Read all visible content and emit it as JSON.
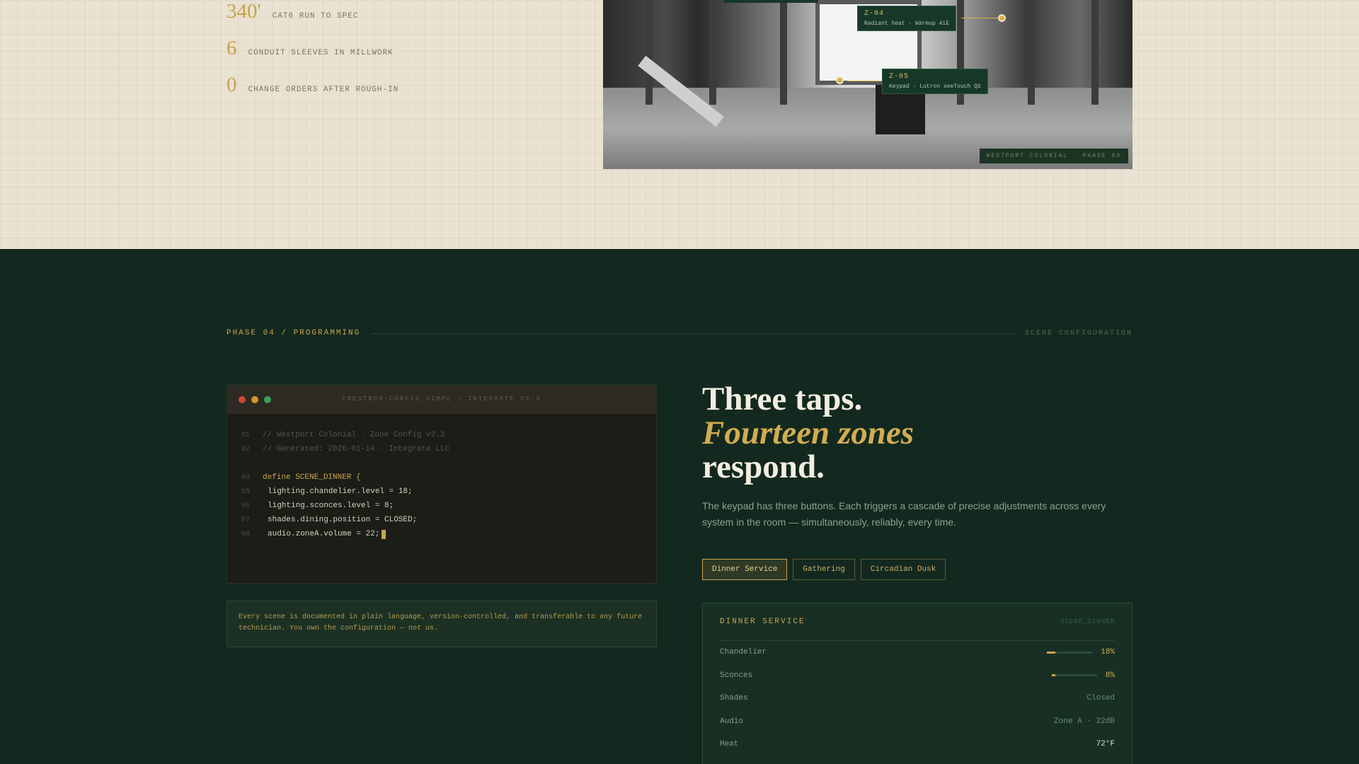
{
  "stats": [
    {
      "num": "340'",
      "label": "CAT6 RUN TO SPEC"
    },
    {
      "num": "6",
      "label": "CONDUIT SLEEVES IN MILLWORK"
    },
    {
      "num": "0",
      "label": "CHANGE ORDERS AFTER ROUGH-IN"
    }
  ],
  "photo": {
    "tags": [
      {
        "id": "Z-04",
        "desc": "Radiant heat · Warmup 4iE"
      },
      {
        "id": "Z-05",
        "desc": "Keypad · Lutron seeTouch QS"
      }
    ],
    "caption": "WESTPORT COLONIAL · PHASE 03"
  },
  "phase": {
    "label": "PHASE 04 / PROGRAMMING",
    "right": "SCENE CONFIGURATION"
  },
  "code": {
    "title": "CRESTRON-CONFIG.SIMPL — INTEGRATE V2.3",
    "lines": [
      {
        "n": "01",
        "text": "// Westport Colonial · Zone Config v2.3"
      },
      {
        "n": "02",
        "text": "// Generated: 2026-01-14 · Integrate LLC"
      },
      {
        "n": "04",
        "text": "define SCENE_DINNER {"
      },
      {
        "n": "05",
        "text": "lighting.chandelier.level = 18;"
      },
      {
        "n": "06",
        "text": "lighting.sconces.level = 8;"
      },
      {
        "n": "07",
        "text": "shades.dining.position = CLOSED;"
      },
      {
        "n": "08",
        "text": "audio.zoneA.volume = 22;"
      }
    ]
  },
  "note": "Every scene is documented in plain language, version-controlled, and transferable to any future technician. You own the configuration — not us.",
  "headline": {
    "line1": "Three taps.",
    "line2": "Fourteen zones",
    "line3": "respond."
  },
  "intro": "The keypad has three buttons. Each triggers a cascade of precise adjustments across every system in the room — simultaneously, reliably, every time.",
  "scenes": [
    {
      "label": "Dinner Service",
      "active": true
    },
    {
      "label": "Gathering",
      "active": false
    },
    {
      "label": "Circadian Dusk",
      "active": false
    }
  ],
  "panel": {
    "title": "DINNER SERVICE",
    "code": "SCENE_DINNER",
    "rows": [
      {
        "label": "Chandelier",
        "value": "18%",
        "level": 0.18
      },
      {
        "label": "Sconces",
        "value": "8%",
        "level": 0.08
      },
      {
        "label": "Shades",
        "value": "Closed"
      },
      {
        "label": "Audio",
        "value": "Zone A · 22dB"
      },
      {
        "label": "Heat",
        "value": "72°F"
      }
    ]
  },
  "colors": {
    "accent": "#c9a44f",
    "dark_bg": "#13291f",
    "light_bg": "#e9e1d1",
    "dot_red": "#d0453a",
    "dot_amber": "#d19a2a",
    "dot_green": "#3aa05a"
  }
}
